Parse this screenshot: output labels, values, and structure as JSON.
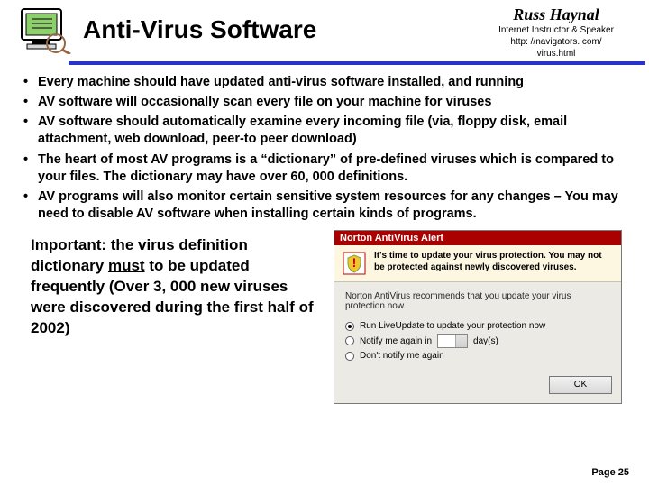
{
  "title": "Anti-Virus Software",
  "author": {
    "name": "Russ Haynal",
    "line1": "Internet Instructor & Speaker",
    "line2": "http: //navigators. com/",
    "line3": "virus.html"
  },
  "bullets": [
    {
      "prefix_underlined": "Every",
      "rest": " machine should have updated anti-virus software installed, and running"
    },
    {
      "text": "AV software will occasionally scan every file on your machine for viruses"
    },
    {
      "text": "AV software should automatically examine every incoming file (via, floppy disk, email attachment, web download,  peer-to peer download)"
    },
    {
      "text": "The heart of most AV programs is a “dictionary” of pre-defined viruses which is compared to your files.  The dictionary may have over 60, 000 definitions."
    },
    {
      "text": "AV programs will also monitor certain sensitive system resources for any changes – You may need to disable AV software when installing certain kinds of programs."
    }
  ],
  "important": {
    "pre": "Important: the virus definition dictionary ",
    "underlined": "must",
    "post": " to be updated frequently (Over 3, 000 new viruses were discovered during the first half of 2002)"
  },
  "norton": {
    "title": "Norton AntiVirus Alert",
    "banner_bold": "It's time to update your virus protection. You may not be protected against newly discovered viruses.",
    "recommend": "Norton AntiVirus recommends that you update your virus protection now.",
    "opt1": "Run LiveUpdate to update your protection now",
    "opt2_pre": "Notify me again in",
    "opt2_post": "day(s)",
    "opt3": "Don't notify me again",
    "ok": "OK"
  },
  "footer": "Page 25"
}
